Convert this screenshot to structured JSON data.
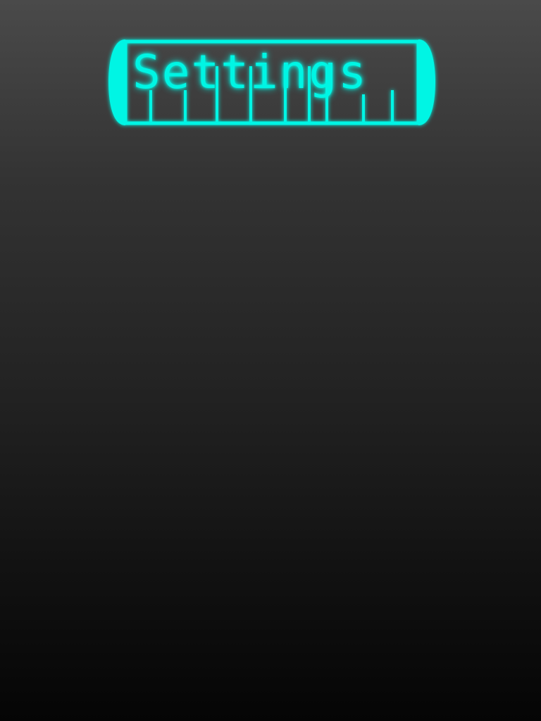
{
  "header": {
    "title": "Settings"
  },
  "theme": {
    "accent": "#00f5e4",
    "glow": "#00fff0",
    "background_top": "#4a4a4a",
    "background_bottom": "#050505"
  }
}
